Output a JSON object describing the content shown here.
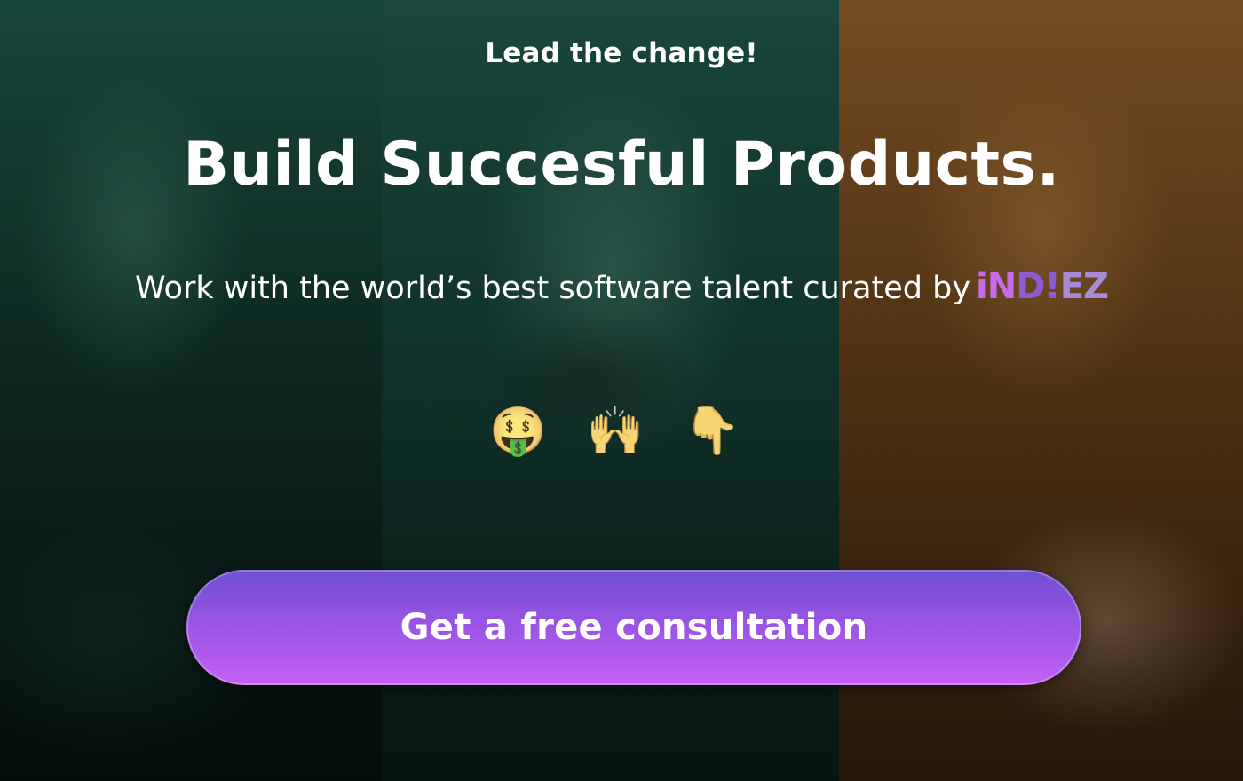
{
  "hero": {
    "eyebrow": "Lead the change!",
    "headline": "Build Succesful Products.",
    "subline": "Work with the world’s best software talent curated by",
    "brand": {
      "part1": "iN",
      "part2": "D!",
      "part3": "EZ"
    },
    "emojis": [
      "🤑",
      "🙌",
      "👇"
    ],
    "cta_label": "Get a free consultation"
  },
  "colors": {
    "cta_top": "#6f4fd0",
    "cta_bottom": "#c460f4",
    "brand_pink": "#c96be8",
    "brand_purple": "#8d5bd3"
  }
}
